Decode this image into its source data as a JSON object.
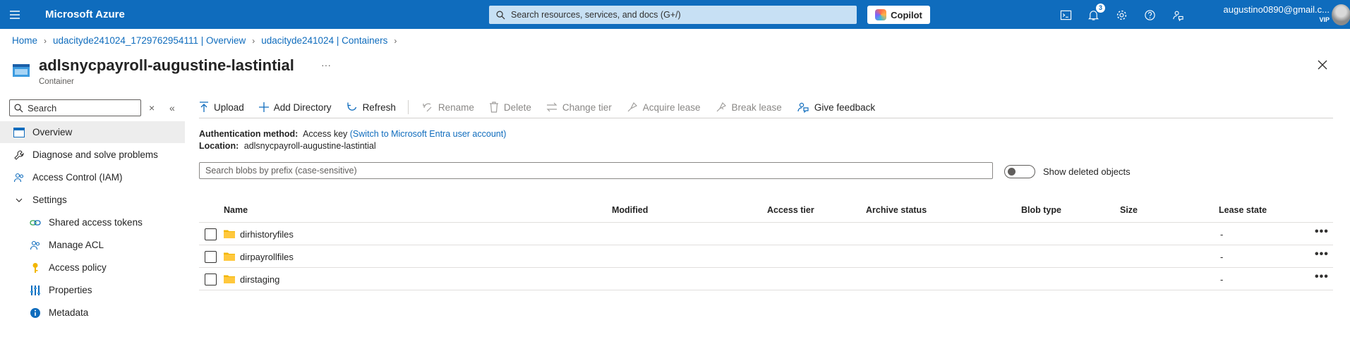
{
  "topbar": {
    "brand": "Microsoft Azure",
    "search_placeholder": "Search resources, services, and docs (G+/)",
    "copilot_label": "Copilot",
    "notification_count": "3",
    "account_email": "augustino0890@gmail.c...",
    "account_tier": "VIP",
    "icons": [
      "hamburger-icon",
      "search-icon",
      "cloud-shell-icon",
      "bell-icon",
      "gear-icon",
      "help-icon",
      "feedback-icon"
    ]
  },
  "breadcrumb": [
    {
      "label": "Home"
    },
    {
      "label": "udacityde241024_1729762954111 | Overview"
    },
    {
      "label": "udacityde241024 | Containers"
    }
  ],
  "header": {
    "title": "adlsnycpayroll-augustine-lastintial",
    "more": "···",
    "subtitle": "Container"
  },
  "sidebar": {
    "search_placeholder": "Search",
    "items": [
      {
        "label": "Overview",
        "icon": "overview-icon",
        "active": true
      },
      {
        "label": "Diagnose and solve problems",
        "icon": "wrench-icon"
      },
      {
        "label": "Access Control (IAM)",
        "icon": "people-icon"
      },
      {
        "label": "Settings",
        "icon": "chevron-down-icon"
      },
      {
        "label": "Shared access tokens",
        "icon": "link-icon"
      },
      {
        "label": "Manage ACL",
        "icon": "people-icon"
      },
      {
        "label": "Access policy",
        "icon": "key-icon"
      },
      {
        "label": "Properties",
        "icon": "properties-icon"
      },
      {
        "label": "Metadata",
        "icon": "info-icon"
      }
    ]
  },
  "toolbar": {
    "upload": "Upload",
    "add_directory": "Add Directory",
    "refresh": "Refresh",
    "rename": "Rename",
    "delete": "Delete",
    "change_tier": "Change tier",
    "acquire_lease": "Acquire lease",
    "break_lease": "Break lease",
    "give_feedback": "Give feedback"
  },
  "info": {
    "auth_label": "Authentication method:",
    "auth_value": "Access key",
    "auth_link": "(Switch to Microsoft Entra user account)",
    "location_label": "Location:",
    "location_value": "adlsnycpayroll-augustine-lastintial"
  },
  "blob_search_placeholder": "Search blobs by prefix (case-sensitive)",
  "show_deleted_label": "Show deleted objects",
  "table": {
    "columns": [
      "Name",
      "Modified",
      "Access tier",
      "Archive status",
      "Blob type",
      "Size",
      "Lease state"
    ],
    "rows": [
      {
        "name": "dirhistoryfiles",
        "lease": "-"
      },
      {
        "name": "dirpayrollfiles",
        "lease": "-"
      },
      {
        "name": "dirstaging",
        "lease": "-"
      }
    ],
    "row_more": "•••"
  },
  "colors": {
    "brand_blue": "#0f6cbd",
    "folder_yellow": "#f2b600"
  }
}
